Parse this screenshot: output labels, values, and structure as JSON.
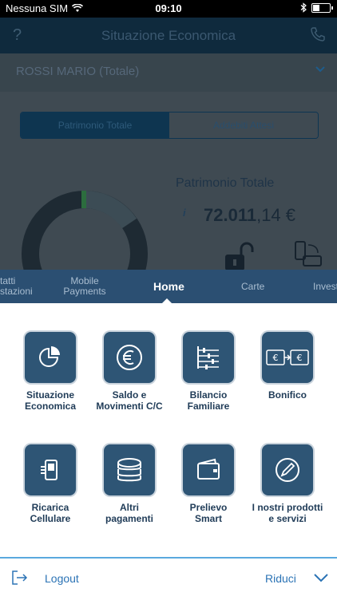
{
  "status_bar": {
    "carrier": "Nessuna SIM",
    "time": "09:10"
  },
  "header": {
    "title": "Situazione Economica",
    "help": "?"
  },
  "account": {
    "name": "ROSSI MARIO (Totale)"
  },
  "segments": [
    "Patrimonio Totale",
    "Addebiti Attesi"
  ],
  "summary": {
    "title": "Patrimonio Totale",
    "info": "i",
    "amount_int": "72.011",
    "amount_dec": ",14 €"
  },
  "tabs": {
    "partial_left": [
      "tatti",
      "stazioni"
    ],
    "mobile_payments": [
      "Mobile",
      "Payments"
    ],
    "home": "Home",
    "carte": "Carte",
    "partial_right": "Invest"
  },
  "menu": [
    {
      "label1": "Situazione",
      "label2": "Economica",
      "icon": "pie-chart-icon"
    },
    {
      "label1": "Saldo e",
      "label2": "Movimenti C/C",
      "icon": "euro-icon"
    },
    {
      "label1": "Bilancio",
      "label2": "Familiare",
      "icon": "sliders-icon"
    },
    {
      "label1": "Bonifico",
      "label2": "",
      "icon": "transfer-icon"
    },
    {
      "label1": "Ricarica",
      "label2": "Cellulare",
      "icon": "mobile-recharge-icon"
    },
    {
      "label1": "Altri",
      "label2": "pagamenti",
      "icon": "coins-icon"
    },
    {
      "label1": "Prelievo",
      "label2": "Smart",
      "icon": "wallet-icon"
    },
    {
      "label1": "I nostri prodotti",
      "label2": "e servizi",
      "icon": "pen-circle-icon"
    }
  ],
  "bottom": {
    "logout": "Logout",
    "reduce": "Riduci"
  },
  "colors": {
    "accent": "#2b73b5",
    "tab_bar": "#2b4f72",
    "tile": "#2e5575"
  }
}
